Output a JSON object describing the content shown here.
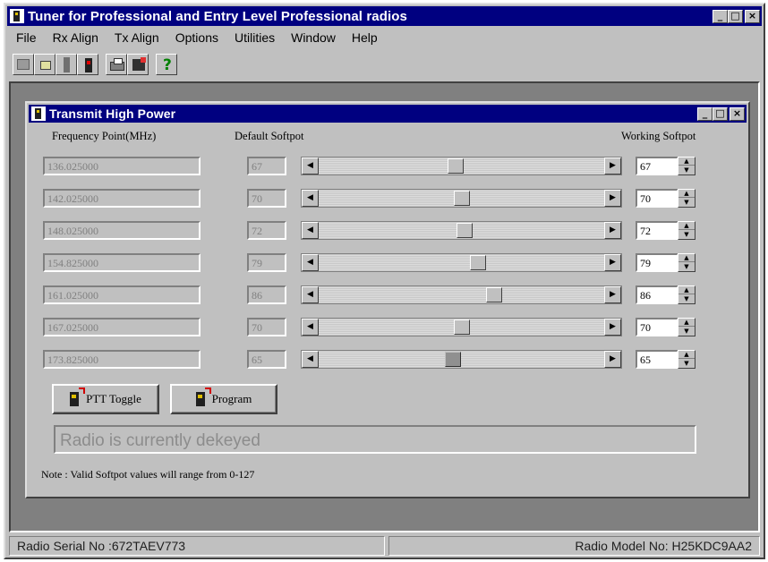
{
  "app": {
    "title": "Tuner for Professional and Entry Level Professional radios",
    "window_buttons": {
      "minimize": "_",
      "maximize": "□",
      "close": "×"
    }
  },
  "menu": [
    "File",
    "Rx Align",
    "Tx Align",
    "Options",
    "Utilities",
    "Window",
    "Help"
  ],
  "toolbar": {
    "icons": [
      "open-radio-icon",
      "read-radio-icon",
      "write-radio-icon",
      "radio-icon",
      "print-icon",
      "radio-info-icon",
      "help-icon"
    ],
    "help_glyph": "?"
  },
  "child_window": {
    "title": "Transmit High Power",
    "headers": {
      "frequency": "Frequency Point(MHz)",
      "default": "Default Softpot",
      "working": "Working Softpot"
    },
    "rows": [
      {
        "frequency": "136.025000",
        "default": "67",
        "working": "67",
        "slider_fraction": 0.48
      },
      {
        "frequency": "142.025000",
        "default": "70",
        "working": "70",
        "slider_fraction": 0.5
      },
      {
        "frequency": "148.025000",
        "default": "72",
        "working": "72",
        "slider_fraction": 0.51
      },
      {
        "frequency": "154.825000",
        "default": "79",
        "working": "79",
        "slider_fraction": 0.56
      },
      {
        "frequency": "161.025000",
        "default": "86",
        "working": "86",
        "slider_fraction": 0.62
      },
      {
        "frequency": "167.025000",
        "default": "70",
        "working": "70",
        "slider_fraction": 0.5
      },
      {
        "frequency": "173.825000",
        "default": "65",
        "working": "65",
        "slider_fraction": 0.47,
        "active": true
      }
    ],
    "buttons": {
      "ptt_toggle": "PTT Toggle",
      "program": "Program"
    },
    "status_message": "Radio is currently dekeyed",
    "note": "Note : Valid Softpot values will range from 0-127"
  },
  "statusbar": {
    "serial": "Radio Serial No :672TAEV773",
    "model": "Radio Model No: H25KDC9AA2"
  }
}
